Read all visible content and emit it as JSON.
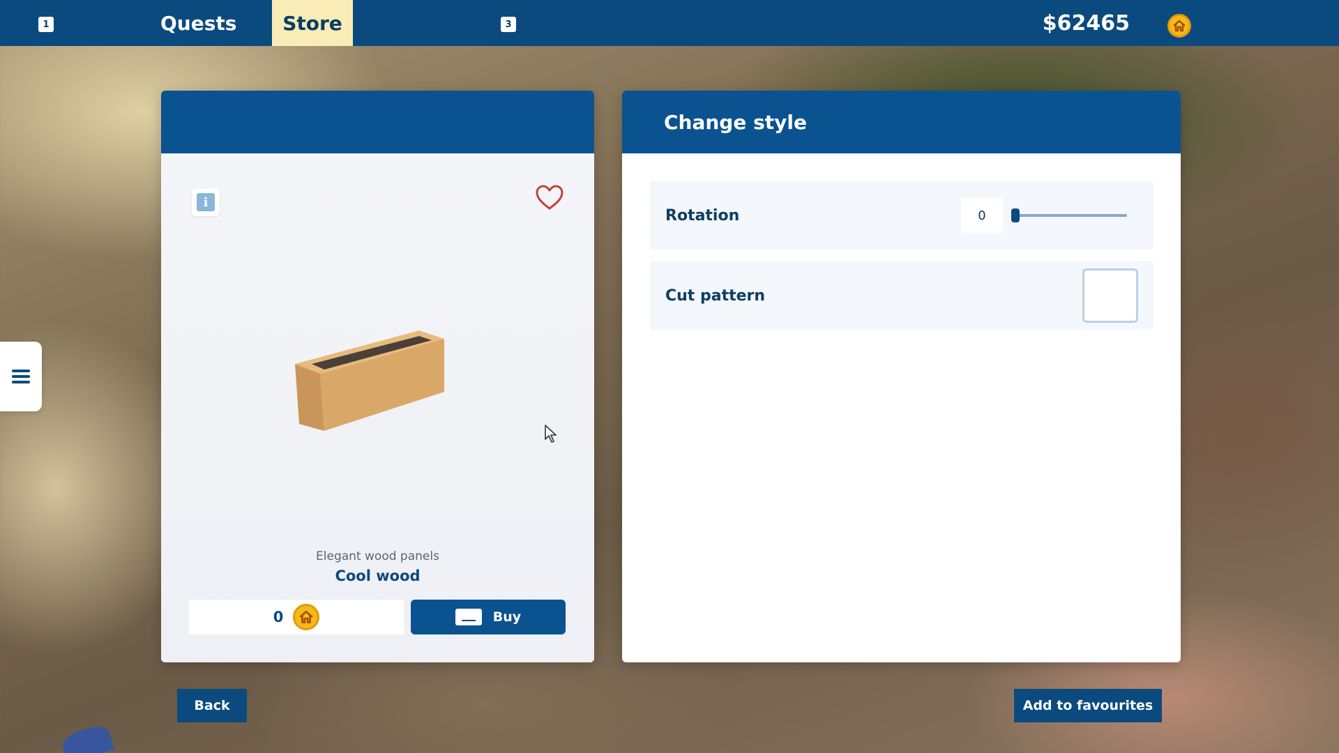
{
  "topbar": {
    "key_left": "1",
    "tabs": [
      {
        "label": "Quests",
        "active": false
      },
      {
        "label": "Store",
        "active": true
      }
    ],
    "key_right": "3",
    "money": "$62465",
    "currency_icon": "house-coin-icon"
  },
  "product": {
    "header_title": "",
    "subtitle": "Elegant wood panels",
    "name": "Cool wood",
    "price": "0",
    "buy_label": "Buy",
    "favourite_icon": "heart-outline-icon",
    "info_icon": "info-icon"
  },
  "style_panel": {
    "title": "Change style",
    "rotation_label": "Rotation",
    "rotation_value": "0",
    "rotation_fraction": 0.0,
    "cut_pattern_label": "Cut pattern"
  },
  "footer": {
    "back_label": "Back",
    "add_fav_label": "Add to favourites"
  },
  "colors": {
    "primary": "#0b4a7e",
    "header": "#0b5291",
    "active_tab": "#f9ecb6",
    "coin": "#f7b81a"
  }
}
